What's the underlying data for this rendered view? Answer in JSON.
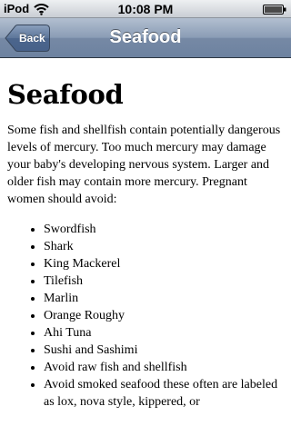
{
  "status_bar": {
    "carrier": "iPod",
    "time": "10:08 PM"
  },
  "nav": {
    "back_label": "Back",
    "title": "Seafood"
  },
  "content": {
    "heading": "Seafood",
    "intro": "Some fish and shellfish contain potentially dangerous levels of mercury. Too much mercury may damage your baby's developing nervous system. Larger and older fish may contain more mercury. Pregnant women should avoid:",
    "items": [
      "Swordfish",
      "Shark",
      "King Mackerel",
      "Tilefish",
      "Marlin",
      "Orange Roughy",
      "Ahi Tuna",
      "Sushi and Sashimi",
      "Avoid raw fish and shellfish",
      "Avoid smoked seafood these often are labeled as lox, nova style, kippered, or"
    ]
  },
  "icons": {
    "wifi": "wifi-icon",
    "battery": "battery-icon"
  }
}
